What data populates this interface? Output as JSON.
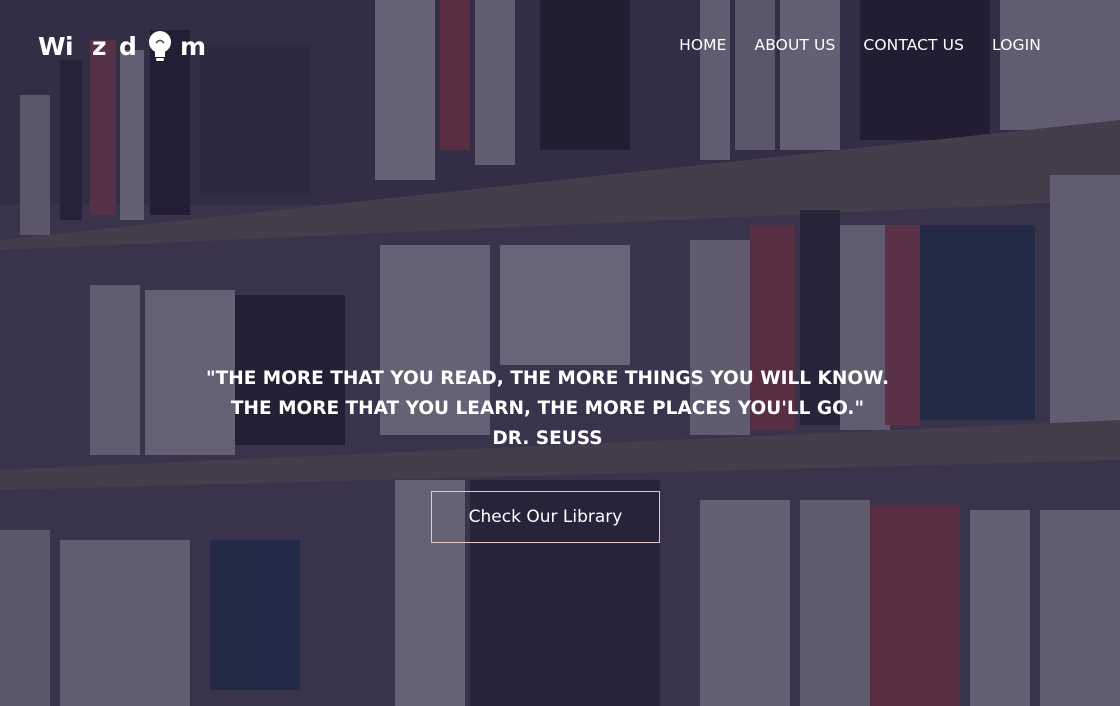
{
  "brand": {
    "logo_letters": [
      "W",
      "i",
      "z",
      "d",
      "m"
    ],
    "logo_icon": "lightbulb-icon"
  },
  "nav": {
    "items": [
      {
        "label": "HOME"
      },
      {
        "label": "ABOUT US"
      },
      {
        "label": "CONTACT US"
      },
      {
        "label": "LOGIN"
      }
    ]
  },
  "hero": {
    "quote_line1": "\"THE MORE THAT YOU READ, THE MORE THINGS YOU WILL KNOW.",
    "quote_line2": "THE MORE THAT YOU LEARN, THE MORE PLACES YOU'LL GO.\"",
    "author": "DR. SEUSS",
    "cta_label": "Check Our Library",
    "background_image": "bookshelf-photo"
  },
  "colors": {
    "overlay": "#1c1630",
    "text": "#ffffff",
    "cta_border": "#e8c7c0"
  }
}
